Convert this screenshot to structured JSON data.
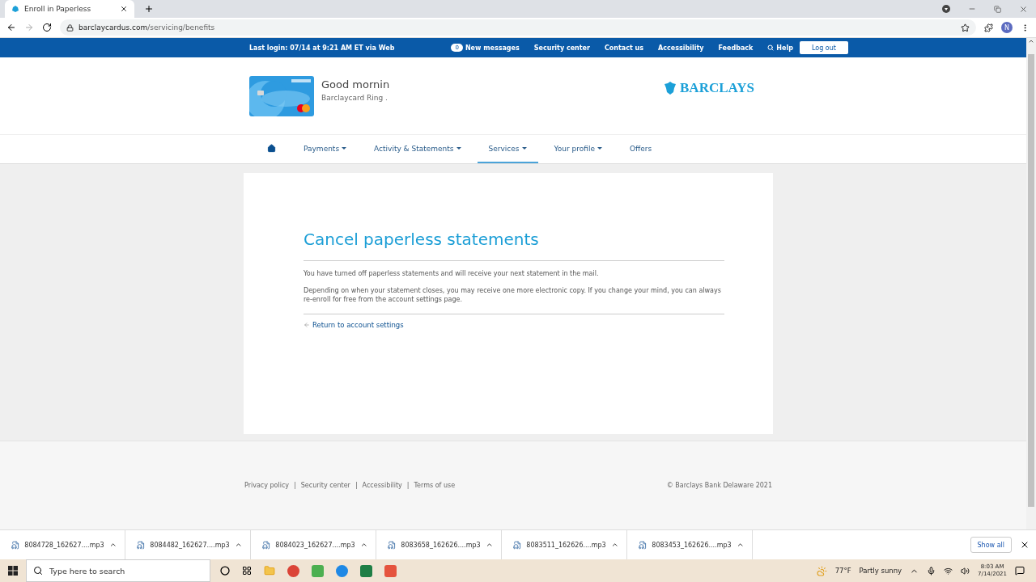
{
  "browser": {
    "tab_title": "Enroll in Paperless",
    "url_host": "barclaycardus.com",
    "url_path": "/servicing/benefits",
    "profile_initial": "N"
  },
  "top_bar": {
    "last_login": "Last login: 07/14 at 9:21 AM ET via Web",
    "message_count": "0",
    "links": [
      {
        "label": "New messages",
        "kind": "messages"
      },
      {
        "label": "Security center",
        "kind": "plain"
      },
      {
        "label": "Contact us",
        "kind": "plain"
      },
      {
        "label": "Accessibility",
        "kind": "plain"
      },
      {
        "label": "Feedback",
        "kind": "plain"
      },
      {
        "label": "Help",
        "kind": "search"
      }
    ],
    "logout": "Log out"
  },
  "header": {
    "greeting": "Good mornin",
    "card_name": "Barclaycard Ring .",
    "logo": "BARCLAYS"
  },
  "nav": [
    {
      "kind": "home",
      "selected": false
    },
    {
      "label": "Payments",
      "kind": "menu",
      "selected": false
    },
    {
      "label": "Activity & Statements",
      "kind": "menu",
      "selected": false
    },
    {
      "label": "Services",
      "kind": "menu",
      "selected": true
    },
    {
      "label": "Your profile",
      "kind": "menu",
      "selected": false
    },
    {
      "label": "Offers",
      "kind": "link",
      "selected": false
    }
  ],
  "content": {
    "title": "Cancel paperless statements",
    "paragraphs": [
      "You have turned off paperless statements and will receive your next statement in the mail.",
      "Depending on when your statement closes, you may receive one more electronic copy. If you change your mind, you can always re-enroll for free from the account settings page."
    ],
    "back_link": "Return to account settings"
  },
  "footer": {
    "separator": "|",
    "links": [
      "Privacy policy",
      "Security center",
      "Accessibility",
      "Terms of use"
    ],
    "copyright": "© Barclays Bank Delaware 2021"
  },
  "downloads": {
    "files": [
      "8084728_162627....mp3",
      "8084482_162627....mp3",
      "8084023_162627....mp3",
      "8083658_162626....mp3",
      "8083511_162626....mp3",
      "8083453_162626....mp3"
    ],
    "show_all": "Show all"
  },
  "taskbar": {
    "search_placeholder": "Type here to search",
    "weather": "77°F",
    "weather_text": "Partly sunny",
    "time": "8:03 AM",
    "date": "7/14/2021"
  }
}
